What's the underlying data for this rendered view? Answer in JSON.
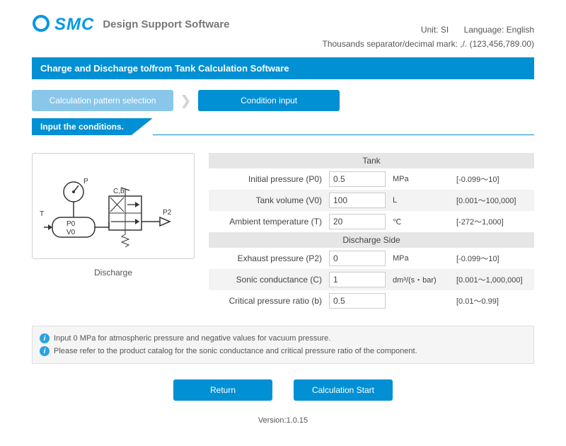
{
  "header": {
    "brand": "SMC",
    "software_title": "Design Support Software",
    "unit_label": "Unit:",
    "unit_value": "SI",
    "language_label": "Language:",
    "language_value": "English",
    "separator_note": "Thousands separator/decimal mark: ,/. (123,456,789.00)"
  },
  "banner": "Charge and Discharge to/from Tank Calculation Software",
  "tabs": {
    "left": "Calculation pattern selection",
    "right": "Condition input"
  },
  "ribbon": "Input the conditions.",
  "diagram": {
    "caption": "Discharge",
    "labels": {
      "P": "P",
      "T": "T",
      "Cb": "C,b",
      "P0": "P0",
      "V0": "V0",
      "P2": "P2"
    }
  },
  "sections": {
    "tank": {
      "title": "Tank",
      "rows": [
        {
          "label": "Initial pressure (P0)",
          "value": "0.5",
          "unit": "MPa",
          "range": "[-0.099～10]"
        },
        {
          "label": "Tank volume (V0)",
          "value": "100",
          "unit": "L",
          "range": "[0.001～100,000]"
        },
        {
          "label": "Ambient temperature (T)",
          "value": "20",
          "unit": "℃",
          "range": "[-272～1,000]"
        }
      ]
    },
    "discharge": {
      "title": "Discharge Side",
      "rows": [
        {
          "label": "Exhaust pressure (P2)",
          "value": "0",
          "unit": "MPa",
          "range": "[-0.099～10]"
        },
        {
          "label": "Sonic conductance (C)",
          "value": "1",
          "unit": "dm³/(s・bar)",
          "range": "[0.001～1,000,000]"
        },
        {
          "label": "Critical pressure ratio (b)",
          "value": "0.5",
          "unit": "",
          "range": "[0.01～0.99]"
        }
      ]
    }
  },
  "notes": {
    "line1": "Input 0 MPa for atmospheric pressure and negative values for vacuum pressure.",
    "line2": "Please refer to the product catalog for the sonic conductance and critical pressure ratio of the component."
  },
  "buttons": {
    "return": "Return",
    "start": "Calculation Start"
  },
  "version_label": "Version:",
  "version": "1.0.15"
}
